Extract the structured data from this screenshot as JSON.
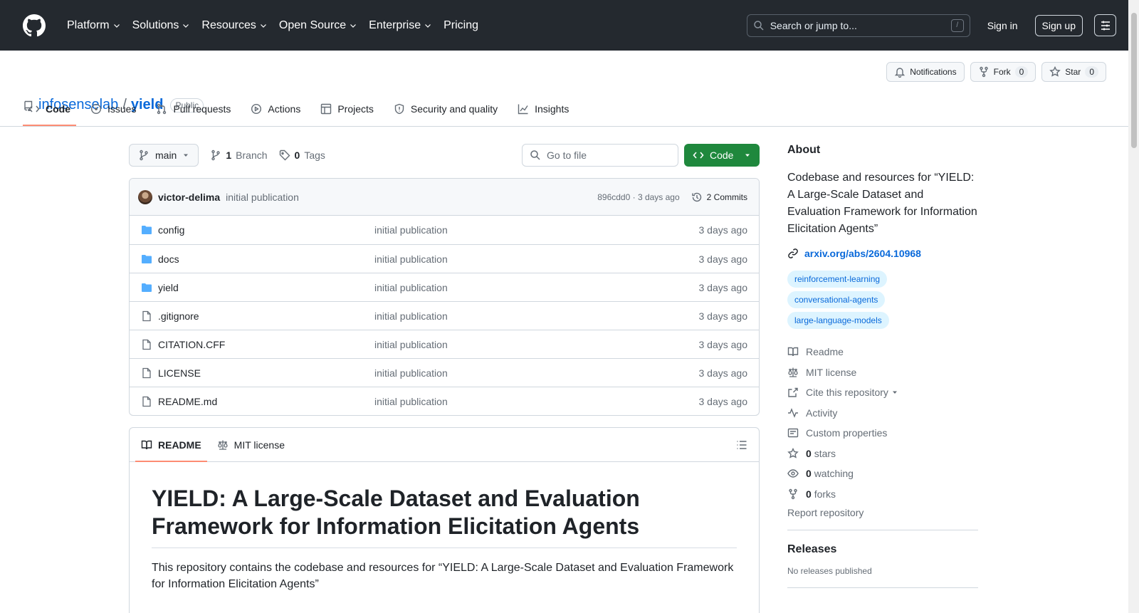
{
  "header": {
    "nav": [
      {
        "label": "Platform",
        "dropdown": true
      },
      {
        "label": "Solutions",
        "dropdown": true
      },
      {
        "label": "Resources",
        "dropdown": true
      },
      {
        "label": "Open Source",
        "dropdown": true
      },
      {
        "label": "Enterprise",
        "dropdown": true
      },
      {
        "label": "Pricing",
        "dropdown": false
      }
    ],
    "search_placeholder": "Search or jump to...",
    "search_shortcut": "/",
    "sign_in": "Sign in",
    "sign_up": "Sign up"
  },
  "repo": {
    "owner": "infosenselab",
    "separator": "/",
    "name": "yield",
    "visibility": "Public",
    "notifications_label": "Notifications",
    "fork_label": "Fork",
    "fork_count": "0",
    "star_label": "Star",
    "star_count": "0",
    "tabs": [
      {
        "label": "Code",
        "icon": "code-icon",
        "active": true
      },
      {
        "label": "Issues",
        "icon": "issue-icon",
        "active": false
      },
      {
        "label": "Pull requests",
        "icon": "pull-request-icon",
        "active": false
      },
      {
        "label": "Actions",
        "icon": "play-icon",
        "active": false
      },
      {
        "label": "Projects",
        "icon": "table-icon",
        "active": false
      },
      {
        "label": "Security and quality",
        "icon": "shield-icon",
        "active": false
      },
      {
        "label": "Insights",
        "icon": "graph-icon",
        "active": false
      }
    ]
  },
  "toolbar": {
    "branch": "main",
    "branch_count": "1",
    "branch_label": "Branch",
    "tag_count": "0",
    "tag_label": "Tags",
    "goto_placeholder": "Go to file",
    "code_label": "Code"
  },
  "commit": {
    "author": "victor-delima",
    "message": "initial publication",
    "meta": "896cdd0 · 3 days ago",
    "commits_label": "2 Commits"
  },
  "files": [
    {
      "name": "config",
      "type": "folder",
      "message": "initial publication",
      "date": "3 days ago"
    },
    {
      "name": "docs",
      "type": "folder",
      "message": "initial publication",
      "date": "3 days ago"
    },
    {
      "name": "yield",
      "type": "folder",
      "message": "initial publication",
      "date": "3 days ago"
    },
    {
      "name": ".gitignore",
      "type": "file",
      "message": "initial publication",
      "date": "3 days ago"
    },
    {
      "name": "CITATION.CFF",
      "type": "file",
      "message": "initial publication",
      "date": "3 days ago"
    },
    {
      "name": "LICENSE",
      "type": "file",
      "message": "initial publication",
      "date": "3 days ago"
    },
    {
      "name": "README.md",
      "type": "file",
      "message": "initial publication",
      "date": "3 days ago"
    }
  ],
  "readme": {
    "tab_readme": "README",
    "tab_license": "MIT license",
    "title": "YIELD: A Large-Scale Dataset and Evaluation Framework for Information Elicitation Agents",
    "intro": "This repository contains the codebase and resources for “YIELD: A Large-Scale Dataset and Evaluation Framework for Information Elicitation Agents”"
  },
  "about": {
    "heading": "About",
    "description": "Codebase and resources for “YIELD: A Large-Scale Dataset and Evaluation Framework for Information Elicitation Agents”",
    "link": "arxiv.org/abs/2604.10968",
    "topics": [
      "reinforcement-learning",
      "conversational-agents",
      "large-language-models"
    ],
    "readme": "Readme",
    "license": "MIT license",
    "cite": "Cite this repository",
    "activity": "Activity",
    "custom_properties": "Custom properties",
    "stars_count": "0",
    "stars_label": "stars",
    "watching_count": "0",
    "watching_label": "watching",
    "forks_count": "0",
    "forks_label": "forks",
    "report": "Report repository",
    "releases_heading": "Releases",
    "no_releases": "No releases published"
  },
  "colors": {
    "header_bg": "#24292f",
    "link": "#0969da",
    "code_button": "#1f883d",
    "active_tab_underline": "#fd8c73"
  }
}
